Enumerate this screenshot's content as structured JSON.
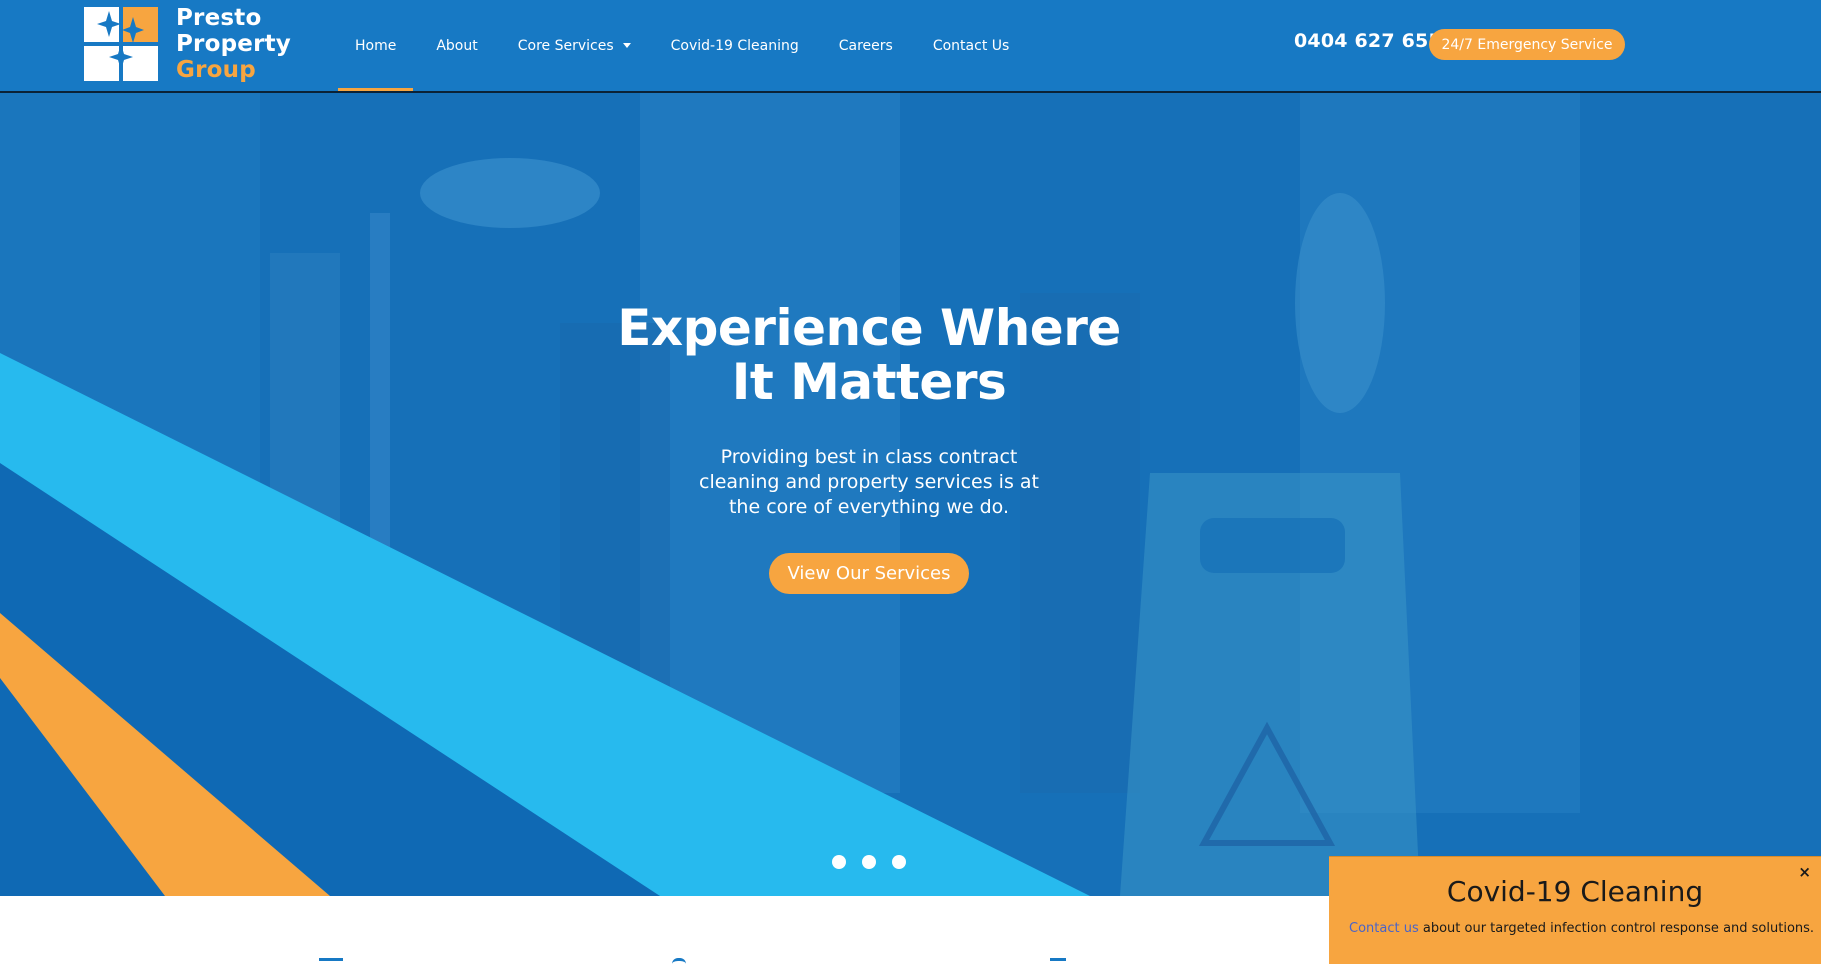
{
  "brand": {
    "line1": "Presto",
    "line2": "Property",
    "line3": "Group",
    "white": "#ffffff",
    "orange": "#f7a540"
  },
  "nav": {
    "items": [
      {
        "label": "Home",
        "active": true
      },
      {
        "label": "About"
      },
      {
        "label": "Core Services",
        "has_dropdown": true
      },
      {
        "label": "Covid-19 Cleaning"
      },
      {
        "label": "Careers"
      },
      {
        "label": "Contact Us"
      }
    ]
  },
  "header": {
    "phone": "0404 627 655",
    "emergency_label": "24/7 Emergency Service",
    "background": "#1779c4"
  },
  "hero": {
    "title_line1": "Experience Where",
    "title_line2": "It Matters",
    "subtitle_line1": "Providing best in class contract",
    "subtitle_line2": "cleaning and property services is at",
    "subtitle_line3": "the core of everything we do.",
    "cta_label": "View Our Services",
    "slides": 3
  },
  "covid_popup": {
    "title": "Covid-19 Cleaning",
    "link_text": "Contact us",
    "body_text": " about our targeted infection control response and solutions.",
    "close_symbol": "×"
  },
  "colors": {
    "accent": "#f7a540",
    "primary": "#1779c4",
    "light_blue": "#27baee",
    "deep_blue": "#0f69b4"
  }
}
